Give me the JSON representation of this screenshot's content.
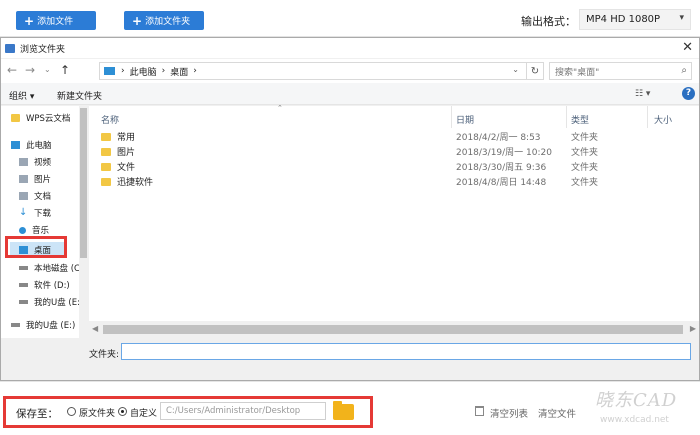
{
  "appbar": {
    "add_file": "添加文件",
    "add_folder": "添加文件夹",
    "format_label": "输出格式：",
    "format_value": "MP4  HD 1080P"
  },
  "dialog": {
    "title": "浏览文件夹",
    "breadcrumb": [
      "此电脑",
      "桌面"
    ],
    "search_placeholder": "搜索\"桌面\"",
    "toolbar": {
      "organize": "组织 ▾",
      "new_folder": "新建文件夹"
    },
    "sidebar": [
      {
        "label": "WPS云文档",
        "icon": "folder-icon"
      },
      {
        "label": "此电脑",
        "icon": "computer-icon"
      },
      {
        "label": "视频",
        "icon": "video-icon"
      },
      {
        "label": "图片",
        "icon": "picture-icon"
      },
      {
        "label": "文档",
        "icon": "document-icon"
      },
      {
        "label": "下载",
        "icon": "download-icon"
      },
      {
        "label": "音乐",
        "icon": "music-icon"
      },
      {
        "label": "桌面",
        "icon": "desktop-icon"
      },
      {
        "label": "本地磁盘 (C",
        "icon": "drive-icon"
      },
      {
        "label": "软件 (D:)",
        "icon": "drive-icon"
      },
      {
        "label": "我的U盘 (E:",
        "icon": "usb-icon"
      },
      {
        "label": "我的U盘 (E:)",
        "icon": "usb-icon"
      }
    ],
    "columns": {
      "name": "名称",
      "date": "日期",
      "type": "类型",
      "size": "大小"
    },
    "files": [
      {
        "name": "常用",
        "date": "2018/4/2/周一 8:53",
        "type": "文件夹"
      },
      {
        "name": "图片",
        "date": "2018/3/19/周一 10:20",
        "type": "文件夹"
      },
      {
        "name": "文件",
        "date": "2018/3/30/周五 9:36",
        "type": "文件夹"
      },
      {
        "name": "迅捷软件",
        "date": "2018/4/8/周日 14:48",
        "type": "文件夹"
      }
    ],
    "folder_label": "文件夹:",
    "folder_value": ""
  },
  "savebar": {
    "save_to": "保存至：",
    "option_original": "原文件夹",
    "option_custom": "自定义",
    "path": "C:/Users/Administrator/Desktop",
    "clear_list": "清空列表",
    "clear_done": "清空文件",
    "watermark_logo": "晓东CAD",
    "watermark_url": "www.xdcad.net"
  },
  "colors": {
    "accent": "#2c7cd6",
    "highlight": "#e53935",
    "folder": "#f2c744"
  }
}
